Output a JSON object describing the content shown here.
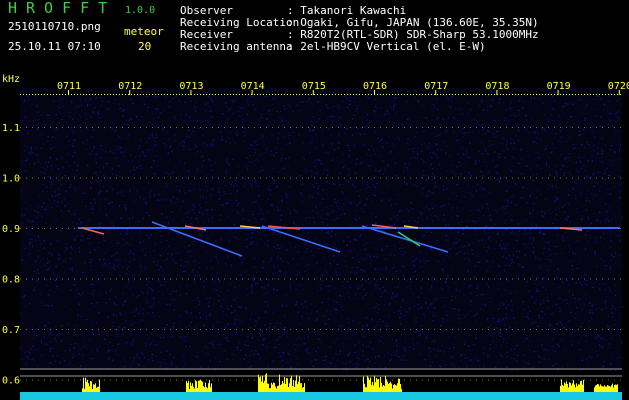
{
  "app": {
    "title": "HROFFT",
    "version": "1.0.0"
  },
  "file": {
    "name": "2510110710.png",
    "timestamp": "25.10.11 07:10"
  },
  "meteor": {
    "label": "meteor",
    "count": "20"
  },
  "info": [
    {
      "key": "Observer",
      "value": ": Takanori Kawachi"
    },
    {
      "key": "Receiving Location",
      "value": ": Ogaki, Gifu, JAPAN (136.60E, 35.35N)"
    },
    {
      "key": "Receiver",
      "value": ": R820T2(RTL-SDR) SDR-Sharp 53.1000MHz"
    },
    {
      "key": "Receiving antenna",
      "value": ": 2el-HB9CV Vertical (el. E-W)"
    }
  ],
  "axes": {
    "freq_unit": "kHz",
    "freq_ticks": [
      "1.1",
      "1.0",
      "0.9",
      "0.8",
      "0.7",
      "0.6"
    ],
    "time_ticks": [
      "0711",
      "0712",
      "0713",
      "0714",
      "0715",
      "0716",
      "0717",
      "0718",
      "0719",
      "0720"
    ]
  },
  "colors": {
    "label": "#ffff3c",
    "title": "#3ecf3e",
    "background": "#000000",
    "echo_line": "#3a6cff"
  }
}
